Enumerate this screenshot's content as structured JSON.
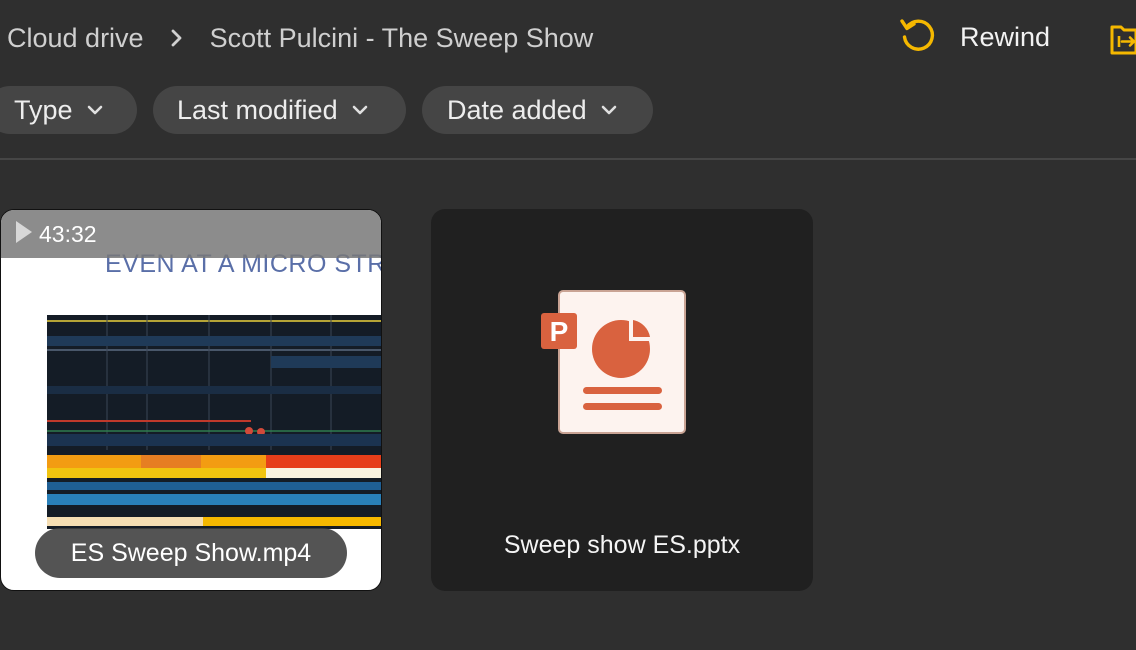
{
  "breadcrumb": {
    "root": "Cloud drive",
    "current": "Scott Pulcini - The Sweep Show"
  },
  "toolbar": {
    "rewind_label": "Rewind",
    "accent": "#f5b800"
  },
  "filters": [
    {
      "label": "Type"
    },
    {
      "label": "Last modified"
    },
    {
      "label": "Date added"
    }
  ],
  "files": [
    {
      "name": "ES Sweep Show.mp4",
      "kind": "video",
      "duration": "43:32",
      "thumbnail_text": "EVEN AT A MICRO STR"
    },
    {
      "name": "Sweep show ES.pptx",
      "kind": "powerpoint",
      "icon_badge": "P",
      "icon_color": "#d9623f"
    }
  ]
}
